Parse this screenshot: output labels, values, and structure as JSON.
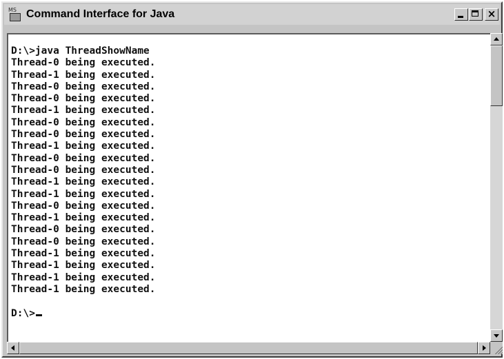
{
  "window": {
    "title": "Command Interface for Java",
    "icon": "ms-dos-icon"
  },
  "console": {
    "lines": [
      "D:\\>java ThreadShowName",
      "Thread-0 being executed.",
      "Thread-1 being executed.",
      "Thread-0 being executed.",
      "Thread-0 being executed.",
      "Thread-1 being executed.",
      "Thread-0 being executed.",
      "Thread-0 being executed.",
      "Thread-1 being executed.",
      "Thread-0 being executed.",
      "Thread-0 being executed.",
      "Thread-1 being executed.",
      "Thread-1 being executed.",
      "Thread-0 being executed.",
      "Thread-1 being executed.",
      "Thread-0 being executed.",
      "Thread-0 being executed.",
      "Thread-1 being executed.",
      "Thread-1 being executed.",
      "Thread-1 being executed.",
      "Thread-1 being executed.",
      "",
      "D:\\>"
    ]
  },
  "colors": {
    "console_background": "#ffffff",
    "console_text": "#111111",
    "chrome": "#c4c4c4"
  }
}
